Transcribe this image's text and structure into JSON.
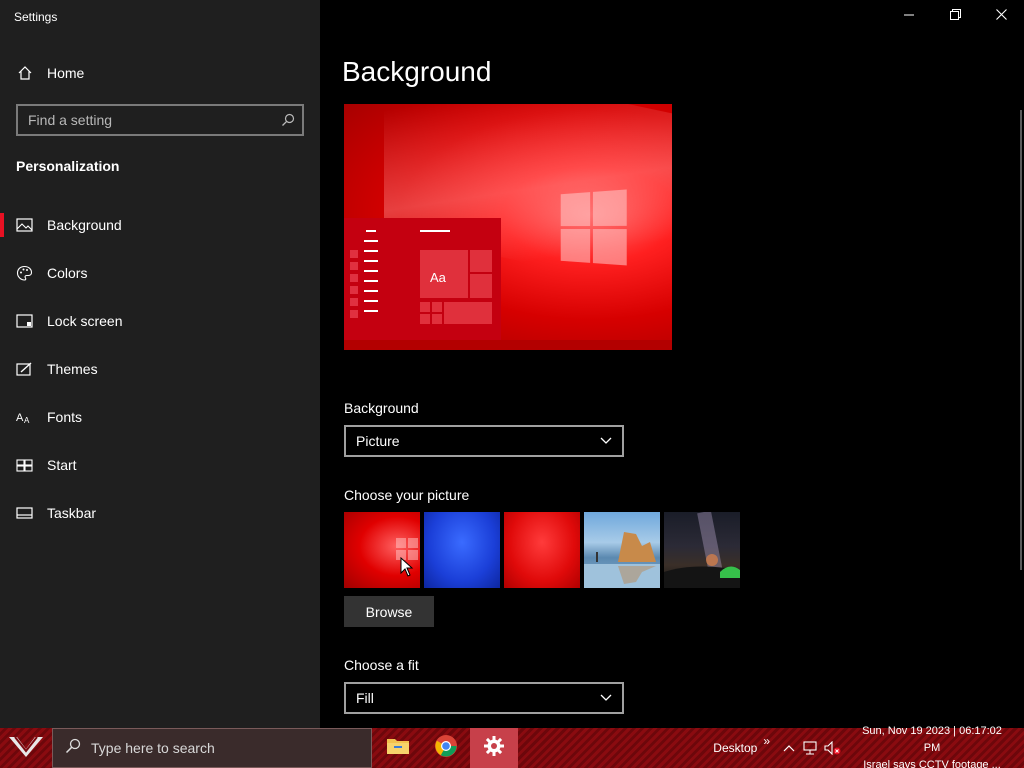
{
  "window": {
    "title": "Settings"
  },
  "sidebar": {
    "home_label": "Home",
    "search_placeholder": "Find a setting",
    "section_title": "Personalization",
    "items": [
      {
        "label": "Background",
        "icon": "picture-icon",
        "active": true
      },
      {
        "label": "Colors",
        "icon": "palette-icon"
      },
      {
        "label": "Lock screen",
        "icon": "lock-screen-icon"
      },
      {
        "label": "Themes",
        "icon": "themes-icon"
      },
      {
        "label": "Fonts",
        "icon": "fonts-icon"
      },
      {
        "label": "Start",
        "icon": "start-icon"
      },
      {
        "label": "Taskbar",
        "icon": "taskbar-icon"
      }
    ]
  },
  "main": {
    "title": "Background",
    "preview_tile_text": "Aa",
    "background_label": "Background",
    "background_value": "Picture",
    "choose_picture_label": "Choose your picture",
    "browse_label": "Browse",
    "fit_label": "Choose a fit",
    "fit_value": "Fill"
  },
  "taskbar": {
    "search_placeholder": "Type here to search",
    "desktop_label": "Desktop",
    "overflow_label": "»",
    "clock_line1": "Sun, Nov 19 2023 | 06:17:02 PM",
    "clock_line2": "Israel says CCTV footage ..."
  },
  "colors": {
    "accent": "#e81123",
    "sidebar_bg": "#1f1f1f",
    "main_bg": "#000000",
    "taskbar_red": "#8a0b10"
  }
}
